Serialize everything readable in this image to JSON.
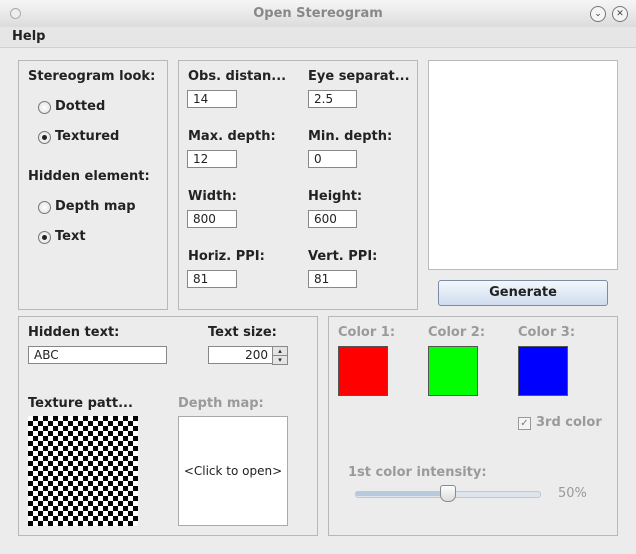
{
  "window": {
    "title": "Open Stereogram",
    "minimize_glyph": "⌄",
    "close_glyph": "✕"
  },
  "menubar": {
    "items": [
      "Help"
    ]
  },
  "look": {
    "heading": "Stereogram look:",
    "options": [
      "Dotted",
      "Textured"
    ],
    "selected": "Textured"
  },
  "hidden_element": {
    "heading": "Hidden element:",
    "options": [
      "Depth map",
      "Text"
    ],
    "selected": "Text"
  },
  "params": {
    "obs_distance": {
      "label": "Obs. distan...",
      "value": "14"
    },
    "eye_separation": {
      "label": "Eye separat...",
      "value": "2.5"
    },
    "max_depth": {
      "label": "Max. depth:",
      "value": "12"
    },
    "min_depth": {
      "label": "Min. depth:",
      "value": "0"
    },
    "width": {
      "label": "Width:",
      "value": "800"
    },
    "height": {
      "label": "Height:",
      "value": "600"
    },
    "horiz_ppi": {
      "label": "Horiz. PPI:",
      "value": "81"
    },
    "vert_ppi": {
      "label": "Vert. PPI:",
      "value": "81"
    }
  },
  "generate_label": "Generate",
  "text_panel": {
    "hidden_text_label": "Hidden text:",
    "hidden_text_value": "ABC",
    "text_size_label": "Text size:",
    "text_size_value": "200",
    "texture_label": "Texture patt...",
    "depth_map_label": "Depth map:",
    "depth_map_placeholder": "<Click to open>"
  },
  "colors": {
    "color1_label": "Color 1:",
    "color1": "#ff0000",
    "color2_label": "Color 2:",
    "color2": "#00ff00",
    "color3_label": "Color 3:",
    "color3": "#0000ff",
    "third_color_label": "3rd color",
    "third_color_checked": true,
    "intensity_label": "1st color intensity:",
    "intensity_value": 0.5,
    "intensity_text": "50%"
  }
}
